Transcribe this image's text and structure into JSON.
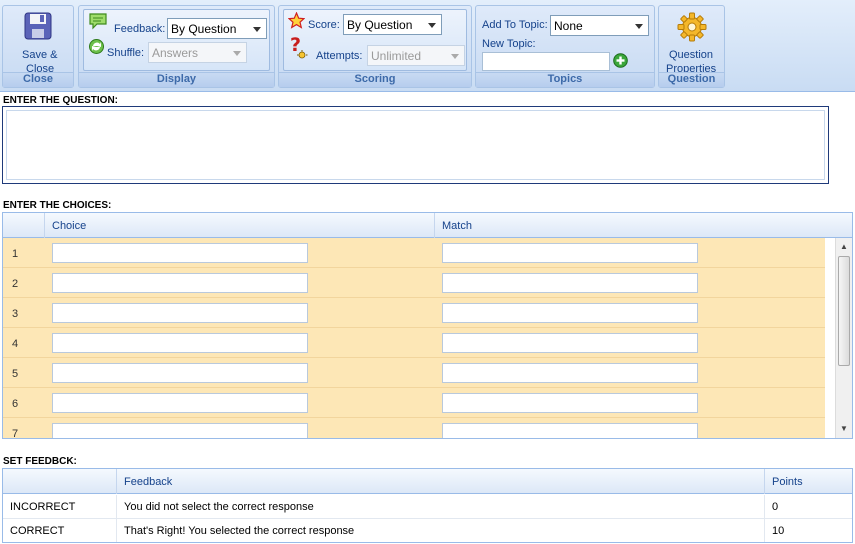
{
  "ribbon": {
    "close_group": {
      "title": "Close",
      "save_close_label_line1": "Save &",
      "save_close_label_line2": "Close"
    },
    "display_group": {
      "title": "Display",
      "feedback_label": "Feedback:",
      "feedback_value": "By Question",
      "shuffle_label": "Shuffle:",
      "shuffle_value": "Answers"
    },
    "scoring_group": {
      "title": "Scoring",
      "score_label": "Score:",
      "score_value": "By Question",
      "attempts_label": "Attempts:",
      "attempts_value": "Unlimited"
    },
    "topics_group": {
      "title": "Topics",
      "add_to_topic_label": "Add To Topic:",
      "add_to_topic_value": "None",
      "new_topic_label": "New Topic:",
      "new_topic_value": ""
    },
    "question_group": {
      "title": "Question",
      "properties_label_line1": "Question",
      "properties_label_line2": "Properties"
    }
  },
  "question_section": {
    "heading": "ENTER THE QUESTION:",
    "value": ""
  },
  "choices_section": {
    "heading": "ENTER THE CHOICES:",
    "columns": {
      "choice": "Choice",
      "match": "Match"
    },
    "rows": [
      {
        "num": "1"
      },
      {
        "num": "2"
      },
      {
        "num": "3"
      },
      {
        "num": "4"
      },
      {
        "num": "5"
      },
      {
        "num": "6"
      },
      {
        "num": "7"
      }
    ]
  },
  "feedback_section": {
    "heading": "SET FEEDBCK:",
    "columns": {
      "feedback": "Feedback",
      "points": "Points"
    },
    "rows": [
      {
        "label": "INCORRECT",
        "feedback": "You did not select the correct response",
        "points": "0"
      },
      {
        "label": "CORRECT",
        "feedback": "That's Right! You selected the correct response",
        "points": "10"
      }
    ]
  },
  "icons": {
    "save": "floppy-disk-icon",
    "feedback": "speech-bubble-icon",
    "shuffle": "refresh-icon",
    "score": "star-icon",
    "attempts": "question-mark-icon",
    "add_topic": "plus-circle-icon",
    "question_properties": "gear-icon"
  },
  "colors": {
    "row_bg": "#fde7b6",
    "header_text": "#15428b",
    "ribbon_bg": "#c9dcf3"
  }
}
